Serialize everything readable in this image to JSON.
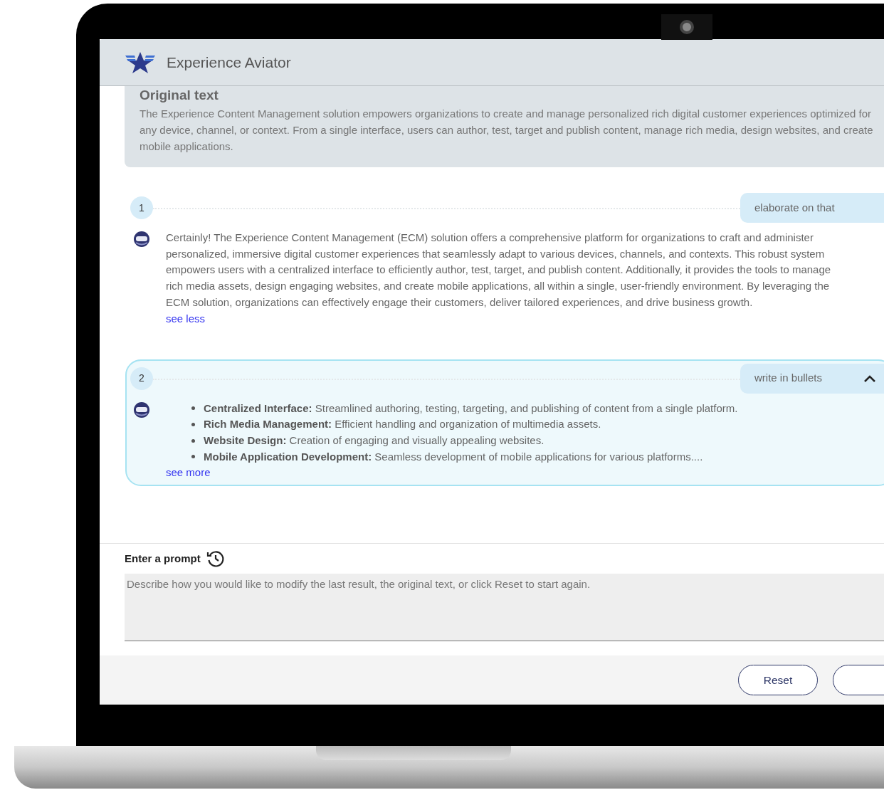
{
  "app": {
    "title": "Experience Aviator"
  },
  "original_text": {
    "title": "Original text",
    "body": "The Experience Content Management solution empowers organizations to create and manage personalized rich digital customer experiences optimized for any device, channel, or context. From a single interface, users can author, test, target and publish content, manage rich media, design websites, and create mobile applications."
  },
  "turns": [
    {
      "number": "1",
      "prompt": "elaborate on that",
      "selected": false,
      "response": {
        "kind": "paragraph",
        "text": "Certainly! The Experience Content Management (ECM) solution offers a comprehensive platform for organizations to craft and administer personalized, immersive digital customer experiences that seamlessly adapt to various devices, channels, and contexts. This robust system empowers users with a centralized interface to efficiently author, test, target, and publish content. Additionally, it provides the tools to manage rich media assets, design engaging websites, and create mobile applications, all within a single, user-friendly environment. By leveraging the ECM solution, organizations can effectively engage their customers, deliver tailored experiences, and drive business growth."
      },
      "toggle": "see less"
    },
    {
      "number": "2",
      "prompt": "write in bullets",
      "selected": true,
      "response": {
        "kind": "bullets",
        "items": [
          "**Centralized Interface:** Streamlined authoring, testing, targeting, and publishing of content from a single platform.",
          "**Rich Media Management:** Efficient handling and organization of multimedia assets.",
          "**Website Design:** Creation of engaging and visually appealing websites.",
          "**Mobile Application Development:** Seamless development of mobile applications for various platforms...."
        ]
      },
      "toggle": "see more"
    }
  ],
  "prompt": {
    "label": "Enter a prompt",
    "placeholder": "Describe how you would like to modify the last result, the original text, or click Reset to start again."
  },
  "buttons": [
    "Reset"
  ]
}
